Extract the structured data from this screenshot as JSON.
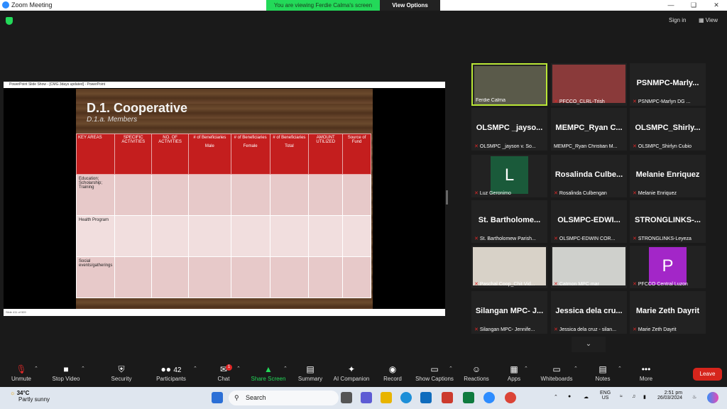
{
  "window": {
    "title": "Zoom Meeting"
  },
  "share_banner": {
    "message": "You are viewing Ferdie Calma's screen",
    "view_options": "View Options"
  },
  "topbar": {
    "sign_in": "Sign in",
    "view": "View"
  },
  "ppt": {
    "title": "PowerPoint Slide Show - [CMG 3days updated] - PowerPoint",
    "status": "Slide 411 of 509"
  },
  "slide": {
    "title": "D.1. Cooperative",
    "subtitle": "D.1.a. Members",
    "headers": [
      "KEY AREAS",
      "SPECIFIC ACTIVITIES",
      "NO. OF ACTIVITIES",
      "# of Beneficiaries\n\nMale",
      "# of Beneficiaries\n\nFemale",
      "# of Beneficiaries\n\nTotal",
      "AMOUNT UTILIZED",
      "Source of Fund"
    ],
    "rows": [
      "Education; Scholarship; Training",
      "Health Program",
      "Social events/gatherings"
    ]
  },
  "participants": [
    {
      "name": "",
      "label": "Ferdie Calma",
      "type": "video",
      "muted": false
    },
    {
      "name": "",
      "label": "PFCCO_CLRL-Trish",
      "type": "video",
      "muted": true
    },
    {
      "name": "PSNMPC-Marly...",
      "label": "PSNMPC-Marlyn DG ...",
      "muted": true
    },
    {
      "name": "OLSMPC _jayso...",
      "label": "OLSMPC _jayson v. So...",
      "muted": true
    },
    {
      "name": "MEMPC_Ryan C...",
      "label": "MEMPC_Ryan Christian M...",
      "muted": false
    },
    {
      "name": "OLSMPC_Shirly...",
      "label": "OLSMPC_Shirlyn Cubio",
      "muted": true
    },
    {
      "name": "",
      "label": "Luz Geronimo",
      "avatar": "L",
      "avatar_color": "#1a5a3a",
      "muted": true
    },
    {
      "name": "Rosalinda Culbe...",
      "label": "Rosalinda Culbengan",
      "muted": true
    },
    {
      "name": "Melanie Enriquez",
      "label": "Melanie Enriquez",
      "muted": true
    },
    {
      "name": "St. Bartholome...",
      "label": "St. Bartholomew Parish...",
      "muted": true
    },
    {
      "name": "OLSMPC-EDWI...",
      "label": "OLSMPC-EDWIN COR...",
      "muted": true
    },
    {
      "name": "STRONGLINKS-...",
      "label": "STRONGLINKS-Leyeza",
      "muted": true
    },
    {
      "name": "",
      "label": "Paschal Coop_Chit Vid...",
      "type": "video",
      "muted": true
    },
    {
      "name": "",
      "label": "Catmon MPC mar",
      "type": "video",
      "muted": true
    },
    {
      "name": "",
      "label": "PFCCO Central Luzon",
      "avatar": "P",
      "avatar_color": "#a326c8",
      "muted": true
    },
    {
      "name": "Silangan MPC- J...",
      "label": "Silangan MPC- Jennife...",
      "muted": true
    },
    {
      "name": "Jessica dela cru...",
      "label": "Jessica dela cruz - silan...",
      "muted": true
    },
    {
      "name": "Marie Zeth Dayrit",
      "label": "Marie Zeth Dayrit",
      "muted": true
    }
  ],
  "toolbar": {
    "unmute": "Unmute",
    "stop_video": "Stop Video",
    "security": "Security",
    "participants": "Participants",
    "participants_count": "42",
    "chat": "Chat",
    "chat_badge": "1",
    "share_screen": "Share Screen",
    "summary": "Summary",
    "ai_companion": "AI Companion",
    "record": "Record",
    "show_captions": "Show Captions",
    "reactions": "Reactions",
    "apps": "Apps",
    "whiteboards": "Whiteboards",
    "notes": "Notes",
    "more": "More",
    "leave": "Leave"
  },
  "taskbar": {
    "temp": "34°C",
    "weather": "Partly sunny",
    "search": "Search",
    "lang1": "ENG",
    "lang2": "US",
    "time": "2:51 pm",
    "date": "26/03/2024"
  }
}
